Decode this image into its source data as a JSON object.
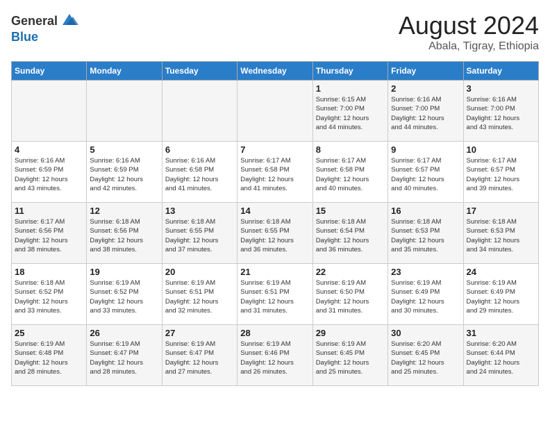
{
  "logo": {
    "text_general": "General",
    "text_blue": "Blue"
  },
  "title": "August 2024",
  "subtitle": "Abala, Tigray, Ethiopia",
  "days_of_week": [
    "Sunday",
    "Monday",
    "Tuesday",
    "Wednesday",
    "Thursday",
    "Friday",
    "Saturday"
  ],
  "weeks": [
    [
      {
        "day": "",
        "info": ""
      },
      {
        "day": "",
        "info": ""
      },
      {
        "day": "",
        "info": ""
      },
      {
        "day": "",
        "info": ""
      },
      {
        "day": "1",
        "info": "Sunrise: 6:15 AM\nSunset: 7:00 PM\nDaylight: 12 hours\nand 44 minutes."
      },
      {
        "day": "2",
        "info": "Sunrise: 6:16 AM\nSunset: 7:00 PM\nDaylight: 12 hours\nand 44 minutes."
      },
      {
        "day": "3",
        "info": "Sunrise: 6:16 AM\nSunset: 7:00 PM\nDaylight: 12 hours\nand 43 minutes."
      }
    ],
    [
      {
        "day": "4",
        "info": "Sunrise: 6:16 AM\nSunset: 6:59 PM\nDaylight: 12 hours\nand 43 minutes."
      },
      {
        "day": "5",
        "info": "Sunrise: 6:16 AM\nSunset: 6:59 PM\nDaylight: 12 hours\nand 42 minutes."
      },
      {
        "day": "6",
        "info": "Sunrise: 6:16 AM\nSunset: 6:58 PM\nDaylight: 12 hours\nand 41 minutes."
      },
      {
        "day": "7",
        "info": "Sunrise: 6:17 AM\nSunset: 6:58 PM\nDaylight: 12 hours\nand 41 minutes."
      },
      {
        "day": "8",
        "info": "Sunrise: 6:17 AM\nSunset: 6:58 PM\nDaylight: 12 hours\nand 40 minutes."
      },
      {
        "day": "9",
        "info": "Sunrise: 6:17 AM\nSunset: 6:57 PM\nDaylight: 12 hours\nand 40 minutes."
      },
      {
        "day": "10",
        "info": "Sunrise: 6:17 AM\nSunset: 6:57 PM\nDaylight: 12 hours\nand 39 minutes."
      }
    ],
    [
      {
        "day": "11",
        "info": "Sunrise: 6:17 AM\nSunset: 6:56 PM\nDaylight: 12 hours\nand 38 minutes."
      },
      {
        "day": "12",
        "info": "Sunrise: 6:18 AM\nSunset: 6:56 PM\nDaylight: 12 hours\nand 38 minutes."
      },
      {
        "day": "13",
        "info": "Sunrise: 6:18 AM\nSunset: 6:55 PM\nDaylight: 12 hours\nand 37 minutes."
      },
      {
        "day": "14",
        "info": "Sunrise: 6:18 AM\nSunset: 6:55 PM\nDaylight: 12 hours\nand 36 minutes."
      },
      {
        "day": "15",
        "info": "Sunrise: 6:18 AM\nSunset: 6:54 PM\nDaylight: 12 hours\nand 36 minutes."
      },
      {
        "day": "16",
        "info": "Sunrise: 6:18 AM\nSunset: 6:53 PM\nDaylight: 12 hours\nand 35 minutes."
      },
      {
        "day": "17",
        "info": "Sunrise: 6:18 AM\nSunset: 6:53 PM\nDaylight: 12 hours\nand 34 minutes."
      }
    ],
    [
      {
        "day": "18",
        "info": "Sunrise: 6:18 AM\nSunset: 6:52 PM\nDaylight: 12 hours\nand 33 minutes."
      },
      {
        "day": "19",
        "info": "Sunrise: 6:19 AM\nSunset: 6:52 PM\nDaylight: 12 hours\nand 33 minutes."
      },
      {
        "day": "20",
        "info": "Sunrise: 6:19 AM\nSunset: 6:51 PM\nDaylight: 12 hours\nand 32 minutes."
      },
      {
        "day": "21",
        "info": "Sunrise: 6:19 AM\nSunset: 6:51 PM\nDaylight: 12 hours\nand 31 minutes."
      },
      {
        "day": "22",
        "info": "Sunrise: 6:19 AM\nSunset: 6:50 PM\nDaylight: 12 hours\nand 31 minutes."
      },
      {
        "day": "23",
        "info": "Sunrise: 6:19 AM\nSunset: 6:49 PM\nDaylight: 12 hours\nand 30 minutes."
      },
      {
        "day": "24",
        "info": "Sunrise: 6:19 AM\nSunset: 6:49 PM\nDaylight: 12 hours\nand 29 minutes."
      }
    ],
    [
      {
        "day": "25",
        "info": "Sunrise: 6:19 AM\nSunset: 6:48 PM\nDaylight: 12 hours\nand 28 minutes."
      },
      {
        "day": "26",
        "info": "Sunrise: 6:19 AM\nSunset: 6:47 PM\nDaylight: 12 hours\nand 28 minutes."
      },
      {
        "day": "27",
        "info": "Sunrise: 6:19 AM\nSunset: 6:47 PM\nDaylight: 12 hours\nand 27 minutes."
      },
      {
        "day": "28",
        "info": "Sunrise: 6:19 AM\nSunset: 6:46 PM\nDaylight: 12 hours\nand 26 minutes."
      },
      {
        "day": "29",
        "info": "Sunrise: 6:19 AM\nSunset: 6:45 PM\nDaylight: 12 hours\nand 25 minutes."
      },
      {
        "day": "30",
        "info": "Sunrise: 6:20 AM\nSunset: 6:45 PM\nDaylight: 12 hours\nand 25 minutes."
      },
      {
        "day": "31",
        "info": "Sunrise: 6:20 AM\nSunset: 6:44 PM\nDaylight: 12 hours\nand 24 minutes."
      }
    ]
  ]
}
